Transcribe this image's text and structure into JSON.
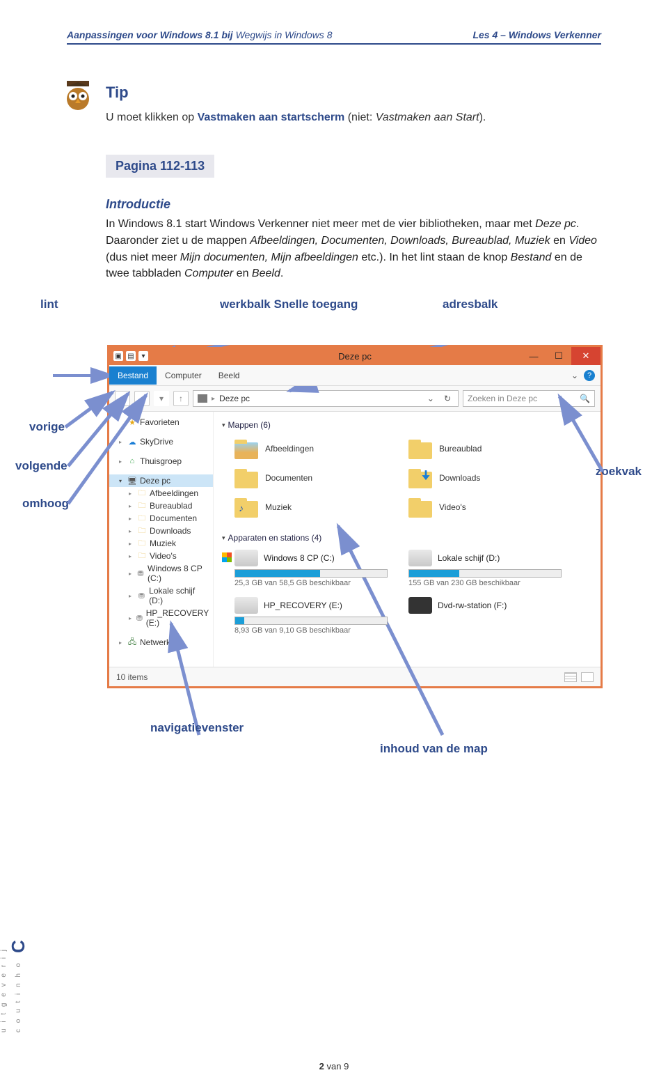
{
  "header": {
    "left_prefix": "Aanpassingen voor Windows 8.1 bij ",
    "left_book": "Wegwijs in Windows 8",
    "right": "Les 4 – Windows Verkenner"
  },
  "tip": {
    "title": "Tip",
    "text_pre": "U moet klikken op ",
    "text_em": "Vastmaken aan startscherm",
    "text_mid": " (niet: ",
    "text_ital": "Vastmaken aan Start",
    "text_post": ")."
  },
  "pagina": "Pagina 112-113",
  "intro_h": "Introductie",
  "body1": "In Windows 8.1 start Windows Verkenner niet meer met de vier bibliotheken, maar met ",
  "body1_ital": "Deze pc",
  "body1_end": ". Daaronder ziet u de mappen ",
  "body_folders": "Afbeeldingen, Documenten, Downloads, Bureaublad, Muziek",
  "body_en": " en ",
  "body_video": "Video",
  "body_paren": " (dus niet meer ",
  "body_mijn1": "Mijn documenten, Mijn afbeeldingen",
  "body_etc": " etc.). In het lint staan de knop ",
  "body_bestand": "Bestand",
  "body_en2": " en de twee tabbladen ",
  "body_comp": "Computer",
  "body_en3": " en ",
  "body_beeld": "Beeld",
  "body_dot": ".",
  "callouts": {
    "lint": "lint",
    "werkbalk": "werkbalk Snelle toegang",
    "adresbalk": "adresbalk",
    "vorige": "vorige",
    "volgende": "volgende",
    "omhoog": "omhoog",
    "zoekvak": "zoekvak",
    "navigatievenster": "navigatievenster",
    "inhoud": "inhoud van de map"
  },
  "explorer": {
    "title": "Deze pc",
    "tabs": {
      "bestand": "Bestand",
      "computer": "Computer",
      "beeld": "Beeld"
    },
    "addr_text": "Deze pc",
    "search_placeholder": "Zoeken in Deze pc",
    "nav": {
      "favorieten": "Favorieten",
      "skydrive": "SkyDrive",
      "thuisgroep": "Thuisgroep",
      "dezepc": "Deze pc",
      "subs": [
        "Afbeeldingen",
        "Bureaublad",
        "Documenten",
        "Downloads",
        "Muziek",
        "Video's",
        "Windows 8 CP (C:)",
        "Lokale schijf (D:)",
        "HP_RECOVERY (E:)"
      ],
      "netwerk": "Netwerk"
    },
    "sections": {
      "mappen": "Mappen (6)",
      "apparaten": "Apparaten en stations (4)"
    },
    "folders": [
      "Afbeeldingen",
      "Bureaublad",
      "Documenten",
      "Downloads",
      "Muziek",
      "Video's"
    ],
    "drives": [
      {
        "name": "Windows 8 CP (C:)",
        "sub": "25,3 GB van 58,5 GB beschikbaar",
        "fill": 56
      },
      {
        "name": "Lokale schijf (D:)",
        "sub": "155 GB van 230 GB beschikbaar",
        "fill": 33
      },
      {
        "name": "HP_RECOVERY (E:)",
        "sub": "8,93 GB van 9,10 GB beschikbaar",
        "fill": 6
      },
      {
        "name": "Dvd-rw-station (F:)",
        "sub": "",
        "fill": -1
      }
    ],
    "status": "10 items"
  },
  "footer": {
    "cur": "2",
    "sep": " van ",
    "tot": "9"
  },
  "publisher": {
    "line1": "u i t g e v e r i j",
    "line2": "c o u t i n h o"
  }
}
